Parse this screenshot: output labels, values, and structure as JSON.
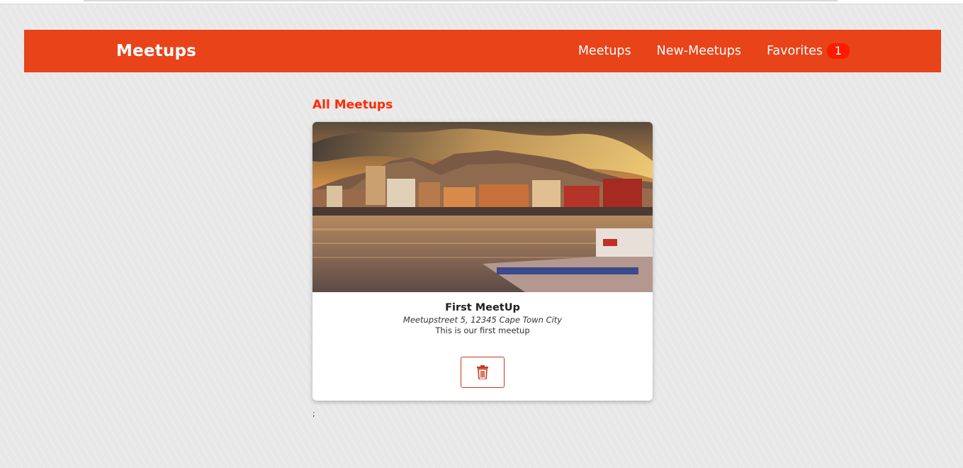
{
  "navbar": {
    "brand": "Meetups",
    "links": [
      {
        "label": "Meetups"
      },
      {
        "label": "New-Meetups"
      },
      {
        "label": "Favorites",
        "badge": "1"
      }
    ]
  },
  "main": {
    "section_title": "All Meetups",
    "meetups": [
      {
        "title": "First MeetUp",
        "address": "Meetupstreet 5, 12345 Cape Town City",
        "description": "This is our first meetup",
        "delete_icon": "trash-icon"
      }
    ],
    "trailing_text": ";"
  },
  "colors": {
    "navbar_bg": "#e84319",
    "accent": "#ff2a00",
    "badge": "#ff1a00",
    "page_bg": "#e8e8e8"
  }
}
